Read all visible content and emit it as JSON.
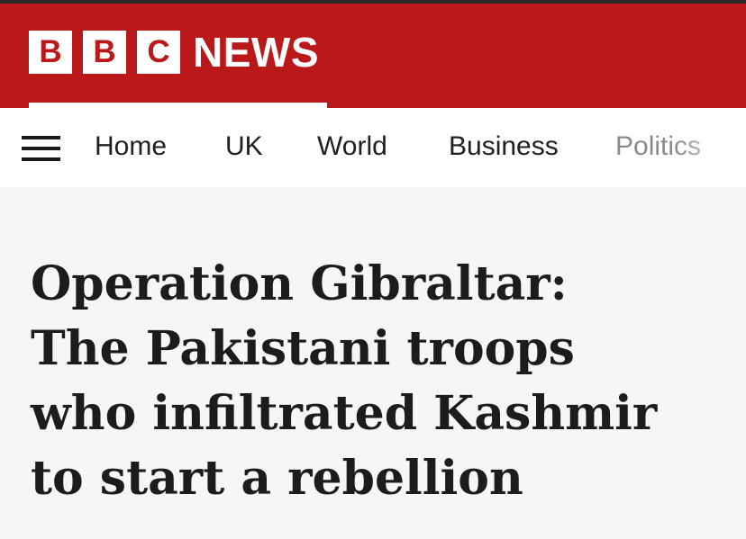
{
  "brand": {
    "letters": [
      "B",
      "B",
      "C"
    ],
    "news_label": "NEWS",
    "accent_color": "#bb1919"
  },
  "nav": {
    "menu_icon": "hamburger-menu-icon",
    "items": [
      {
        "label": "Home"
      },
      {
        "label": "UK"
      },
      {
        "label": "World"
      },
      {
        "label": "Business"
      },
      {
        "label": "Politics"
      }
    ]
  },
  "article": {
    "headline_lines": [
      "Operation Gibraltar:",
      "The Pakistani troops",
      "who infiltrated Kashmir",
      "to start a rebellion"
    ]
  }
}
